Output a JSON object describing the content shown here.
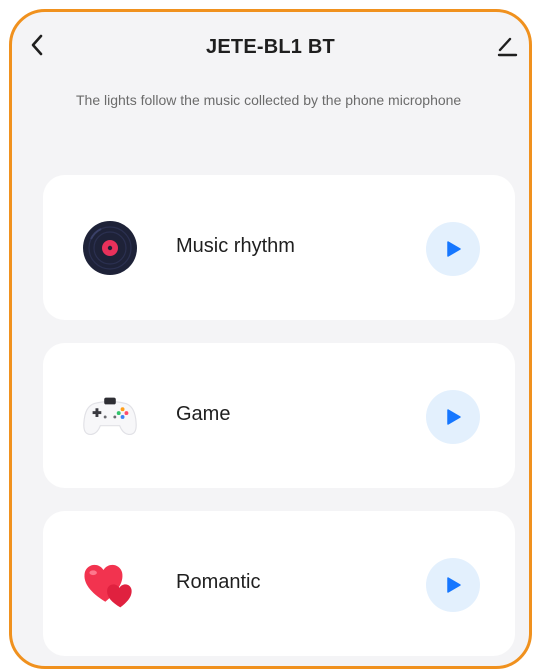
{
  "header": {
    "title": "JETE-BL1 BT",
    "back_icon": "chevron-left-icon",
    "edit_icon": "pencil-icon"
  },
  "description": "The lights follow the music collected by the phone microphone",
  "modes": [
    {
      "label": "Music rhythm",
      "icon": "vinyl-record-icon",
      "action_icon": "play-icon"
    },
    {
      "label": "Game",
      "icon": "gamepad-icon",
      "action_icon": "play-icon"
    },
    {
      "label": "Romantic",
      "icon": "hearts-icon",
      "action_icon": "play-icon"
    }
  ],
  "colors": {
    "frame_border": "#f0911e",
    "background": "#f4f4f6",
    "card": "#ffffff",
    "play_bg": "#e3f0fd",
    "play_icon": "#1677ff",
    "record": "#1e2238",
    "record_center": "#e8315b",
    "heart": "#f2334f"
  }
}
